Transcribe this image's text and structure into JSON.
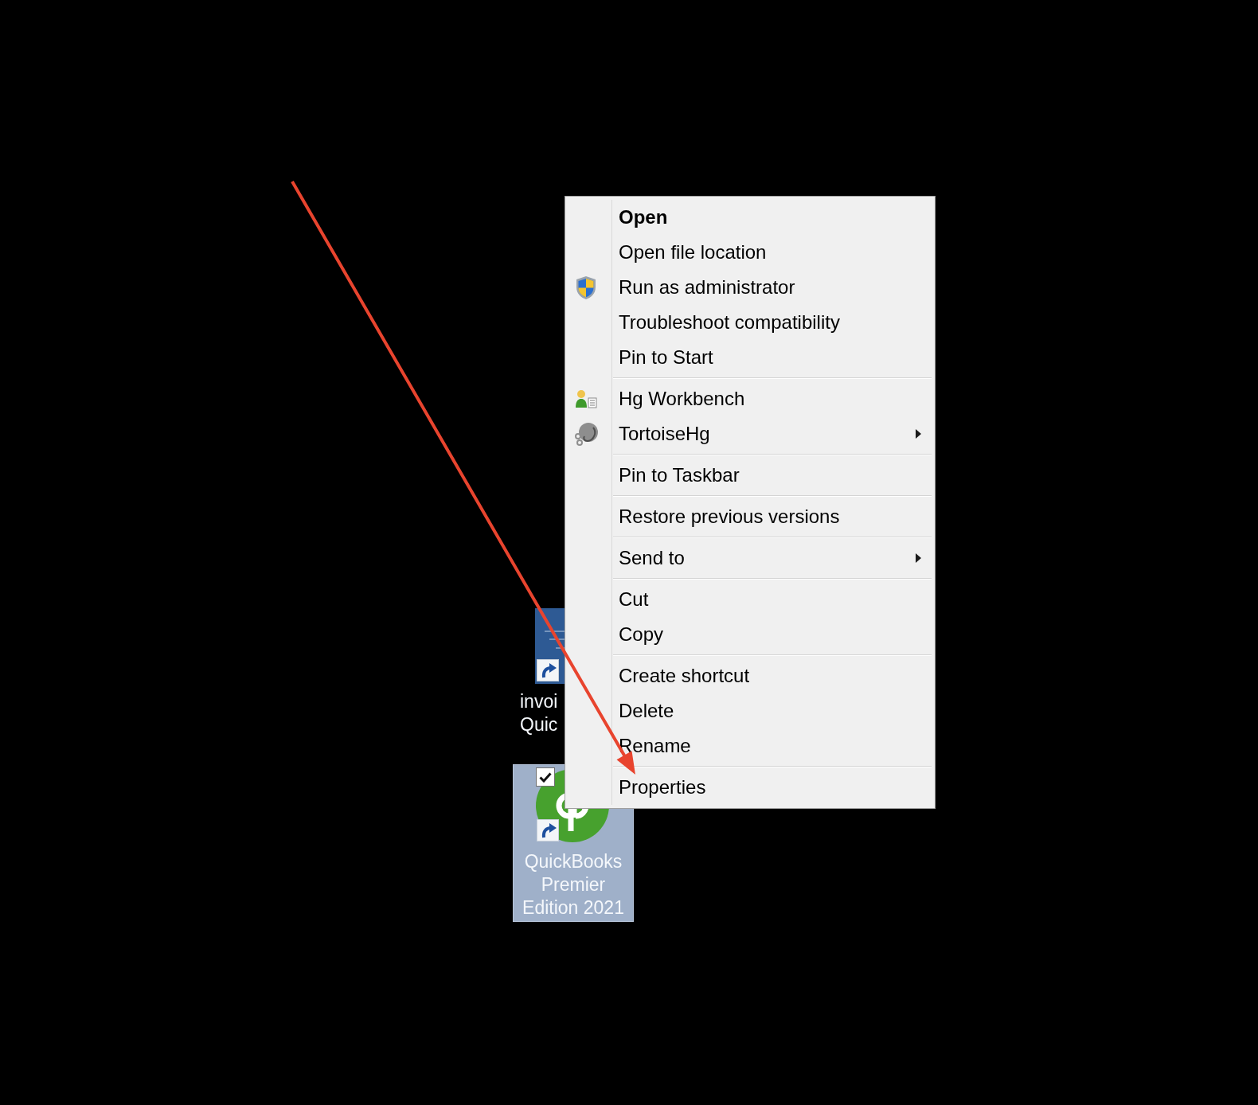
{
  "desktop_icons": [
    {
      "kind": "document",
      "label_lines": [
        "invoi",
        "Quic"
      ],
      "selected": false,
      "checked": false
    },
    {
      "kind": "logo",
      "label_lines": [
        "QuickBooks",
        "Premier",
        "Edition 2021"
      ],
      "selected": true,
      "checked": true
    }
  ],
  "context_menu": {
    "groups": [
      [
        {
          "label": "Open",
          "kind": "plain",
          "default": true,
          "submenu": false
        },
        {
          "label": "Open file location",
          "kind": "plain",
          "default": false,
          "submenu": false
        },
        {
          "label": "Run as administrator",
          "kind": "admin",
          "default": false,
          "submenu": false
        },
        {
          "label": "Troubleshoot compatibility",
          "kind": "plain",
          "default": false,
          "submenu": false
        },
        {
          "label": "Pin to Start",
          "kind": "plain",
          "default": false,
          "submenu": false
        }
      ],
      [
        {
          "label": "Hg Workbench",
          "kind": "workbench",
          "default": false,
          "submenu": false
        },
        {
          "label": "TortoiseHg",
          "kind": "tortoise",
          "default": false,
          "submenu": true
        }
      ],
      [
        {
          "label": "Pin to Taskbar",
          "kind": "plain",
          "default": false,
          "submenu": false
        }
      ],
      [
        {
          "label": "Restore previous versions",
          "kind": "plain",
          "default": false,
          "submenu": false
        }
      ],
      [
        {
          "label": "Send to",
          "kind": "plain",
          "default": false,
          "submenu": true
        }
      ],
      [
        {
          "label": "Cut",
          "kind": "plain",
          "default": false,
          "submenu": false
        },
        {
          "label": "Copy",
          "kind": "plain",
          "default": false,
          "submenu": false
        }
      ],
      [
        {
          "label": "Create shortcut",
          "kind": "plain",
          "default": false,
          "submenu": false
        },
        {
          "label": "Delete",
          "kind": "plain",
          "default": false,
          "submenu": false
        },
        {
          "label": "Rename",
          "kind": "plain",
          "default": false,
          "submenu": false
        }
      ],
      [
        {
          "label": "Properties",
          "kind": "plain",
          "default": false,
          "submenu": false
        }
      ]
    ]
  }
}
